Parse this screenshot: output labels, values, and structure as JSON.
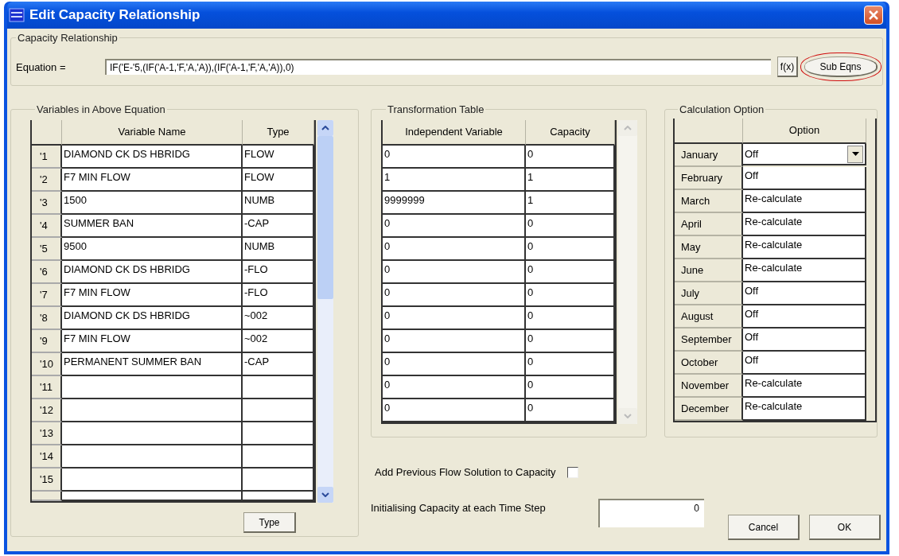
{
  "window": {
    "title": "Edit Capacity Relationship"
  },
  "capacity_relationship": {
    "legend": "Capacity Relationship",
    "equation_label": "Equation =",
    "equation": "IF('E-'5,(IF('A-1,'F,'A,'A)),(IF('A-1,'F,'A,'A)),0)",
    "buttons": [
      {
        "label": "f(x)",
        "circled": false
      },
      {
        "label": "Sub Eqns",
        "circled": true
      }
    ]
  },
  "variables": {
    "legend": "Variables in Above Equation",
    "columns": [
      "Variable Name",
      "Type"
    ],
    "rows": [
      {
        "index": "'1",
        "name": "DIAMOND CK DS HBRIDG",
        "type": "FLOW"
      },
      {
        "index": "'2",
        "name": "F7 MIN FLOW",
        "type": "FLOW"
      },
      {
        "index": "'3",
        "name": "1500",
        "type": "NUMB"
      },
      {
        "index": "'4",
        "name": "SUMMER BAN",
        "type": "-CAP"
      },
      {
        "index": "'5",
        "name": "9500",
        "type": "NUMB"
      },
      {
        "index": "'6",
        "name": "DIAMOND CK DS HBRIDG",
        "type": "-FLO"
      },
      {
        "index": "'7",
        "name": "F7 MIN FLOW",
        "type": "-FLO"
      },
      {
        "index": "'8",
        "name": "DIAMOND CK DS HBRIDG",
        "type": "~002"
      },
      {
        "index": "'9",
        "name": "F7 MIN FLOW",
        "type": "~002"
      },
      {
        "index": "'10",
        "name": "PERMANENT SUMMER BAN",
        "type": "-CAP"
      },
      {
        "index": "'11"
      },
      {
        "index": "'12"
      },
      {
        "index": "'13"
      },
      {
        "index": "'14"
      },
      {
        "index": "'15"
      }
    ],
    "button": "Type"
  },
  "transformation": {
    "legend": "Transformation Table",
    "columns": [
      "Independent Variable",
      "Capacity"
    ],
    "rows": [
      {
        "independent": "0",
        "capacity": "0"
      },
      {
        "independent": "1",
        "capacity": "1"
      },
      {
        "independent": "9999999",
        "capacity": "1"
      },
      {
        "independent": "0",
        "capacity": "0"
      },
      {
        "independent": "0",
        "capacity": "0"
      },
      {
        "independent": "0",
        "capacity": "0"
      },
      {
        "independent": "0",
        "capacity": "0"
      },
      {
        "independent": "0",
        "capacity": "0"
      },
      {
        "independent": "0",
        "capacity": "0"
      },
      {
        "independent": "0",
        "capacity": "0"
      },
      {
        "independent": "0",
        "capacity": "0"
      },
      {
        "independent": "0",
        "capacity": "0"
      }
    ]
  },
  "calculation": {
    "legend": "Calculation Option",
    "columns": [
      "Option"
    ],
    "rows": [
      {
        "month": "January",
        "option": "Off",
        "kind": "dropdown"
      },
      {
        "month": "February",
        "option": "Off",
        "kind": "text"
      },
      {
        "month": "March",
        "option": "Re-calculate",
        "kind": "text"
      },
      {
        "month": "April",
        "option": "Re-calculate",
        "kind": "text"
      },
      {
        "month": "May",
        "option": "Re-calculate",
        "kind": "text"
      },
      {
        "month": "June",
        "option": "Re-calculate",
        "kind": "text"
      },
      {
        "month": "July",
        "option": "Off",
        "kind": "text"
      },
      {
        "month": "August",
        "option": "Off",
        "kind": "text"
      },
      {
        "month": "September",
        "option": "Off",
        "kind": "text"
      },
      {
        "month": "October",
        "option": "Off",
        "kind": "text"
      },
      {
        "month": "November",
        "option": "Re-calculate",
        "kind": "text"
      },
      {
        "month": "December",
        "option": "Re-calculate",
        "kind": "text"
      }
    ]
  },
  "add_previous": {
    "label": "Add Previous Flow Solution to Capacity",
    "checked": false
  },
  "initialising": {
    "label": "Initialising Capacity at each Time Step",
    "value": "0"
  },
  "buttons": [
    "Cancel",
    "OK"
  ]
}
